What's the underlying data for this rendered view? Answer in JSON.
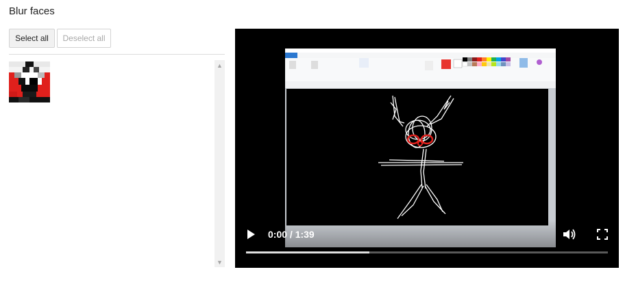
{
  "header": {
    "title": "Blur faces"
  },
  "toolbar": {
    "select_all_label": "Select all",
    "deselect_all_label": "Deselect all"
  },
  "faces": [
    {
      "icon": "blurred-face-thumbnail"
    }
  ],
  "player": {
    "time": "0:00 / 1:39",
    "progress_fraction": 0.34,
    "icons": [
      "play-icon",
      "volume-icon",
      "fullscreen-icon"
    ]
  },
  "colors": {
    "accent_red": "#e0201c",
    "video_bg": "#000000"
  }
}
